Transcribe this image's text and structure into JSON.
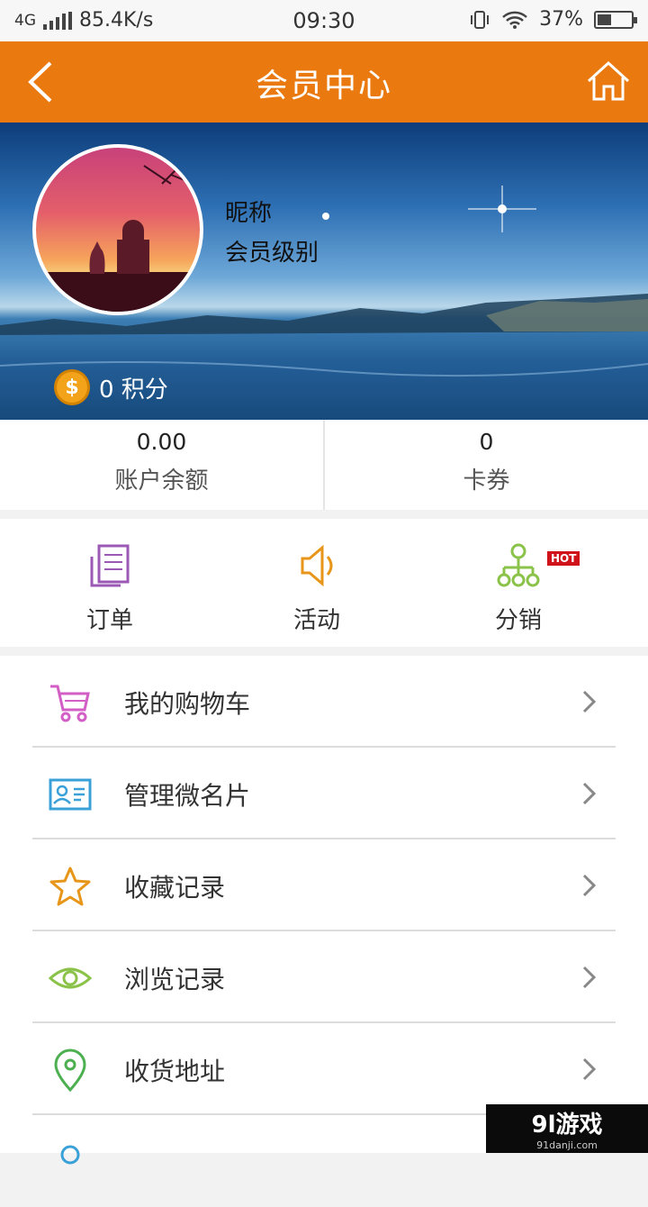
{
  "status_bar": {
    "network": "4G",
    "speed": "85.4K/s",
    "time": "09:30",
    "battery": "37%",
    "battery_level": 0.37
  },
  "header": {
    "title": "会员中心"
  },
  "profile": {
    "nickname": "昵称",
    "level": "会员级别",
    "points": "0 积分"
  },
  "balance": {
    "amount_value": "0.00",
    "amount_label": "账户余额",
    "coupon_value": "0",
    "coupon_label": "卡券"
  },
  "quick_actions": [
    {
      "label": "订单",
      "icon": "document-icon",
      "color": "#9b59b6"
    },
    {
      "label": "活动",
      "icon": "speaker-icon",
      "color": "#e8961a"
    },
    {
      "label": "分销",
      "icon": "network-tree-icon",
      "color": "#8bc34a",
      "badge": "HOT"
    }
  ],
  "menu": [
    {
      "label": "我的购物车",
      "icon": "cart-icon",
      "color": "#d35fc6"
    },
    {
      "label": "管理微名片",
      "icon": "id-card-icon",
      "color": "#3aa0d8"
    },
    {
      "label": "收藏记录",
      "icon": "star-icon",
      "color": "#e8961a"
    },
    {
      "label": "浏览记录",
      "icon": "eye-icon",
      "color": "#8bc34a"
    },
    {
      "label": "收货地址",
      "icon": "location-pin-icon",
      "color": "#4caf50"
    },
    {
      "label": "",
      "icon": "user-icon",
      "color": "#3aa0d8"
    }
  ],
  "watermark": {
    "main": "9l游戏",
    "sub": "91danji.com"
  }
}
